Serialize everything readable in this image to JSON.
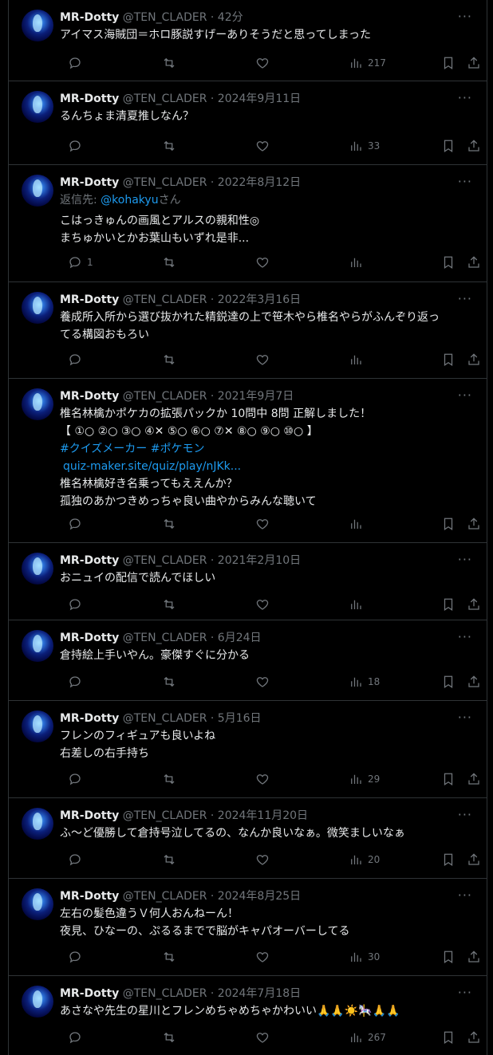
{
  "user": {
    "name": "MR-Dotty",
    "handle": "@TEN_CLADER"
  },
  "tweets": [
    {
      "date": "42分",
      "lines": [
        "アイマス海賊団＝ホロ豚説すげーありそうだと思ってしまった"
      ],
      "views": "217",
      "replies": ""
    },
    {
      "date": "2024年9月11日",
      "lines": [
        "るんちょま清夏推しなん？"
      ],
      "views": "33",
      "replies": ""
    },
    {
      "date": "2022年8月12日",
      "reply_prefix": "返信先: ",
      "reply_to": "@kohakyu",
      "reply_suffix": "さん",
      "lines": [
        "こはっきゅんの画風とアルスの親和性◎",
        "まちゅかいとかお葉山もいずれ是非..."
      ],
      "views": "",
      "replies": "1"
    },
    {
      "date": "2022年3月16日",
      "lines": [
        "養成所入所から選び抜かれた精鋭達の上で笹木やら椎名やらがふんぞり返っ",
        "てる構図おもろい"
      ],
      "views": "",
      "replies": ""
    },
    {
      "date": "2021年9月7日",
      "lines": [
        "椎名林檎かポケカの拡張パックか 10問中 8問 正解しました！",
        "【 ①○ ②○ ③○ ④✕ ⑤○ ⑥○ ⑦✕ ⑧○ ⑨○ ⑩○ 】"
      ],
      "hashtags": "#クイズメーカー #ポケモン",
      "url": "quiz-maker.site/quiz/play/nJKk...",
      "lines2": [
        "椎名林檎好き名乗ってもええんか？",
        "孤独のあかつきめっちゃ良い曲やからみんな聴いて"
      ],
      "views": "",
      "replies": ""
    },
    {
      "date": "2021年2月10日",
      "lines": [
        "おニュイの配信で読んでほしい"
      ],
      "views": "",
      "replies": ""
    },
    {
      "date": "6月24日",
      "lines": [
        "倉持絵上手いやん。豪傑すぐに分かる"
      ],
      "views": "18",
      "replies": ""
    },
    {
      "date": "5月16日",
      "lines": [
        "フレンのフィギュアも良いよね",
        "右差しの右手持ち"
      ],
      "views": "29",
      "replies": ""
    },
    {
      "date": "2024年11月20日",
      "lines": [
        "ふ～ど優勝して倉持号泣してるの、なんか良いなぁ。微笑ましいなぁ"
      ],
      "views": "20",
      "replies": ""
    },
    {
      "date": "2024年8月25日",
      "lines": [
        "左右の髪色違うＶ何人おんねーん！",
        "夜見、ひなーの、ぷるるまでで脳がキャパオーバーしてる"
      ],
      "views": "30",
      "replies": ""
    },
    {
      "date": "2024年7月18日",
      "lines": [
        "あさなや先生の星川とフレンめちゃめちゃかわいい🙏🙏☀️🎠🙏🙏"
      ],
      "views": "267",
      "replies": ""
    }
  ],
  "sep": " · ",
  "more": "···"
}
